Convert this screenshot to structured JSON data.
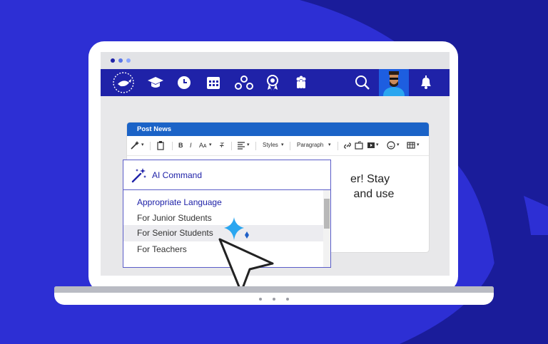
{
  "colors": {
    "background": "#2d2fd4",
    "background_shape": "#1a1c9a",
    "navbar": "#1f22a8",
    "card_header": "#1b63c7",
    "dropdown_border": "#5a5cc8",
    "sparkle": "#2aa6f0"
  },
  "window_dots": [
    "#1f22a8",
    "#5a76e8",
    "#8aa6ff"
  ],
  "navbar": {
    "icons": [
      "laurel-whale-logo-icon",
      "graduation-cap-icon",
      "clock-icon",
      "calendar-icon",
      "network-icon",
      "award-icon",
      "people-icon",
      "search-icon",
      "bell-icon"
    ]
  },
  "editor": {
    "header": "Post News",
    "toolbar": {
      "styles_label": "Styles",
      "paragraph_label": "Paragraph",
      "bold": "B",
      "italic": "I",
      "font_size": "Aᴀ",
      "clear_format": "T"
    },
    "body_text": "er! Stay\n and use"
  },
  "ai_menu": {
    "title": "AI Command",
    "section": "Appropriate Language",
    "items": [
      "For Junior Students",
      "For Senior Students",
      "For Teachers"
    ],
    "highlighted_index": 1
  }
}
